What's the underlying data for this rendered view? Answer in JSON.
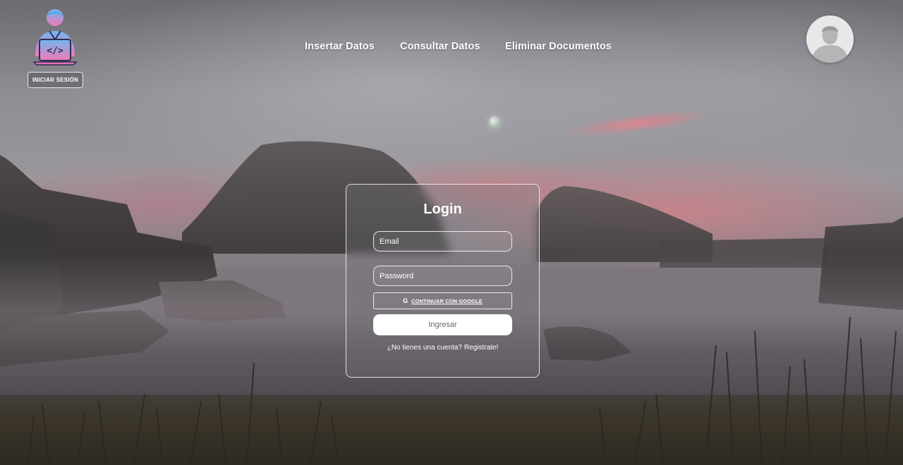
{
  "theme": {
    "logo_gradient_top": "#6fb7f2",
    "logo_gradient_bottom": "#f07ab6",
    "card_border": "#ffffff",
    "submit_bg": "#ffffff"
  },
  "header": {
    "logo_icon": "developer-laptop-icon",
    "login_button_label": "INICIAR SESIÓN",
    "nav": [
      {
        "label": "Insertar Datos"
      },
      {
        "label": "Consultar Datos"
      },
      {
        "label": "Eliminar Documentos"
      }
    ],
    "avatar_icon": "user-avatar-icon"
  },
  "login_card": {
    "title": "Login",
    "email_placeholder": "Email",
    "password_placeholder": "Password",
    "google_icon": "google-g-icon",
    "google_label": "CONTINUAR CON GOOGLE",
    "submit_label": "Ingresar",
    "register_prompt": "¿No tienes una cuenta?",
    "register_link": "Registrate!"
  }
}
